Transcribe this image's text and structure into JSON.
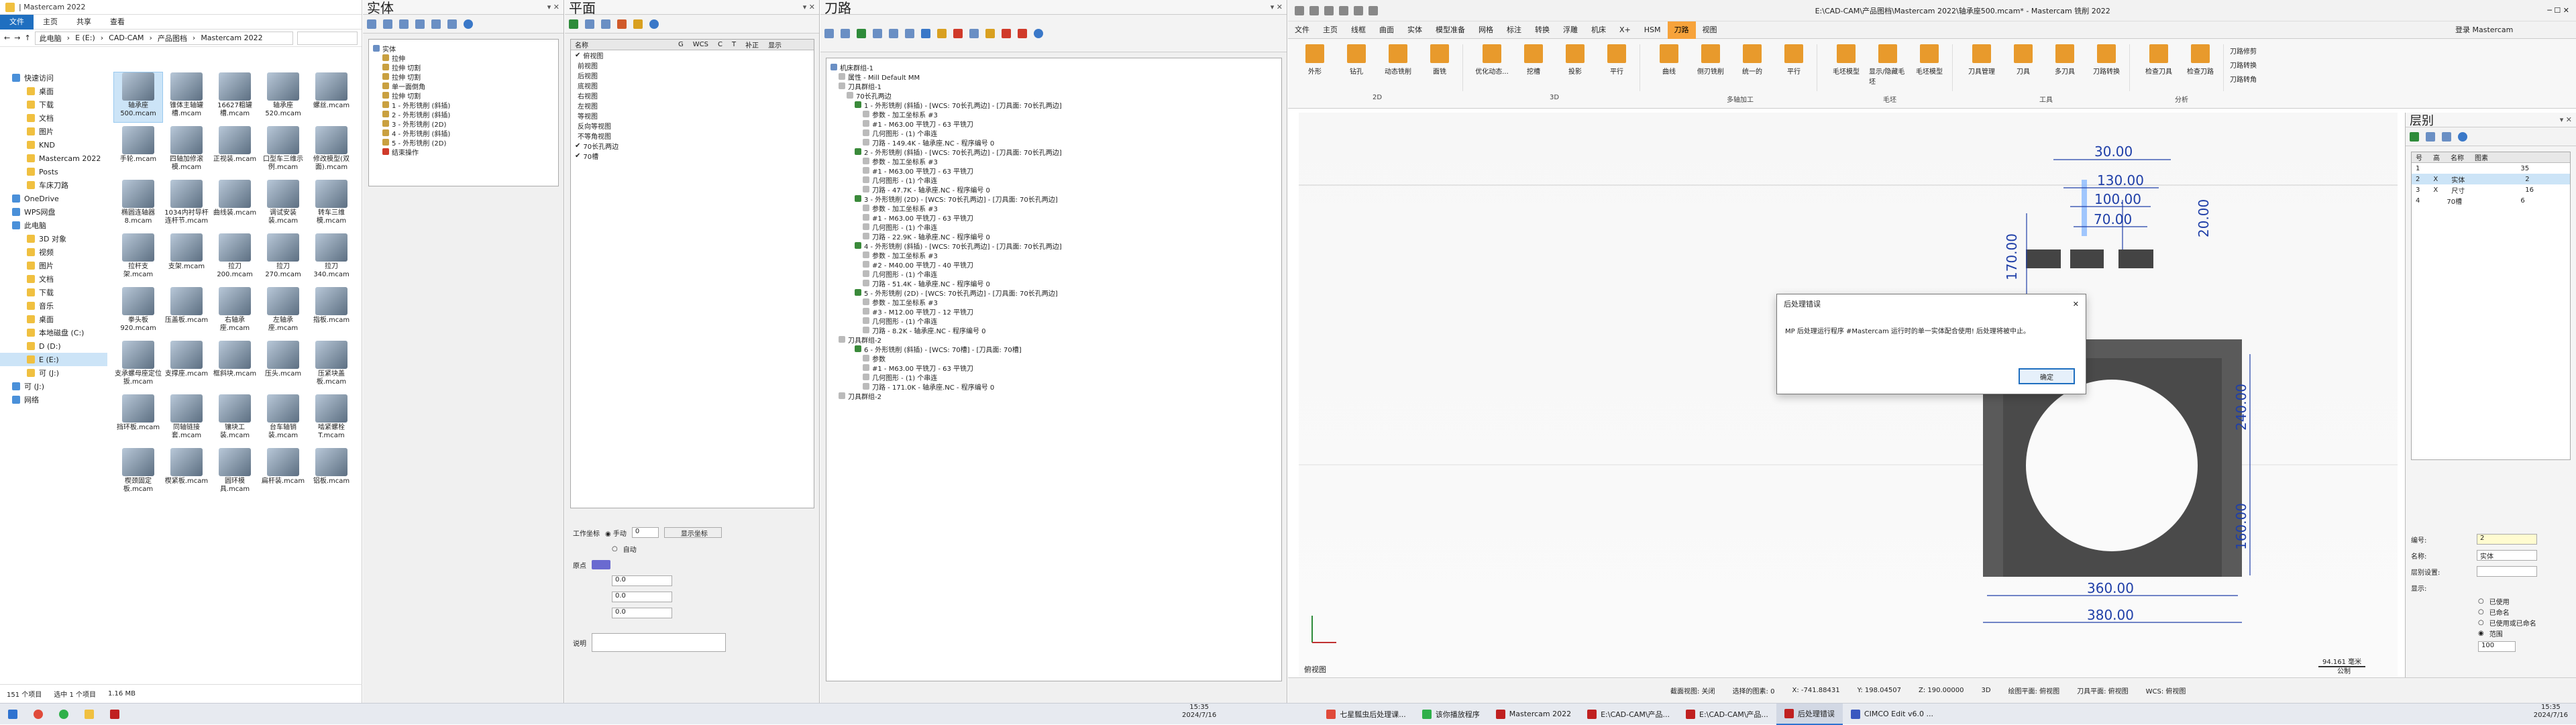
{
  "explorer": {
    "title": "| Mastercam 2022",
    "ribbon_tabs": [
      "文件",
      "主页",
      "共享",
      "查看"
    ],
    "address": [
      "此电脑",
      "E (E:)",
      "CAD-CAM",
      "产品图档",
      "Mastercam 2022"
    ],
    "nav": [
      {
        "label": "快速访问",
        "level": 1
      },
      {
        "label": "桌面",
        "level": 2
      },
      {
        "label": "下载",
        "level": 2
      },
      {
        "label": "文档",
        "level": 2
      },
      {
        "label": "图片",
        "level": 2
      },
      {
        "label": "KND",
        "level": 2
      },
      {
        "label": "Mastercam 2022",
        "level": 2
      },
      {
        "label": "Posts",
        "level": 2
      },
      {
        "label": "车床刀路",
        "level": 2
      },
      {
        "label": "OneDrive",
        "level": 1
      },
      {
        "label": "WPS网盘",
        "level": 1
      },
      {
        "label": "此电脑",
        "level": 1
      },
      {
        "label": "3D 对象",
        "level": 2
      },
      {
        "label": "视频",
        "level": 2
      },
      {
        "label": "图片",
        "level": 2
      },
      {
        "label": "文档",
        "level": 2
      },
      {
        "label": "下载",
        "level": 2
      },
      {
        "label": "音乐",
        "level": 2
      },
      {
        "label": "桌面",
        "level": 2
      },
      {
        "label": "本地磁盘 (C:)",
        "level": 2
      },
      {
        "label": "D (D:)",
        "level": 2
      },
      {
        "label": "E (E:)",
        "level": 2,
        "selected": true
      },
      {
        "label": "可 (J:)",
        "level": 2
      },
      {
        "label": "可 (J:)",
        "level": 1
      },
      {
        "label": "网络",
        "level": 1
      }
    ],
    "files": [
      {
        "name": "轴承座500.mcam",
        "selected": true
      },
      {
        "name": "锥体主轴罐槽.mcam"
      },
      {
        "name": "16627粗罐槽.mcam"
      },
      {
        "name": "轴承座520.mcam"
      },
      {
        "name": "螺丝.mcam"
      },
      {
        "name": "手轮.mcam"
      },
      {
        "name": "四轴加修滚模.mcam"
      },
      {
        "name": "正视装.mcam"
      },
      {
        "name": "口型车三维示例.mcam"
      },
      {
        "name": "修改模型(双面).mcam"
      },
      {
        "name": "椭圆连轴器8.mcam"
      },
      {
        "name": "1034内衬导杆连杆节.mcam"
      },
      {
        "name": "曲线装.mcam"
      },
      {
        "name": "调试安装装.mcam"
      },
      {
        "name": "转车三维模.mcam"
      },
      {
        "name": "拉杆支架.mcam"
      },
      {
        "name": "支架.mcam"
      },
      {
        "name": "拉刀200.mcam"
      },
      {
        "name": "拉刀270.mcam"
      },
      {
        "name": "拉刀340.mcam"
      },
      {
        "name": "拳头板920.mcam"
      },
      {
        "name": "压盖板.mcam"
      },
      {
        "name": "右轴承座.mcam"
      },
      {
        "name": "左轴承座.mcam"
      },
      {
        "name": "指板.mcam"
      },
      {
        "name": "支承螺母座定位扳.mcam"
      },
      {
        "name": "支撑座.mcam"
      },
      {
        "name": "框斜块.mcam"
      },
      {
        "name": "压头.mcam"
      },
      {
        "name": "压紧块盖板.mcam"
      },
      {
        "name": "挡环板.mcam"
      },
      {
        "name": "同轴链接套.mcam"
      },
      {
        "name": "镶块工装.mcam"
      },
      {
        "name": "台车轴销装.mcam"
      },
      {
        "name": "啮紧螺栓T.mcam"
      },
      {
        "name": "楔颈固定板.mcam"
      },
      {
        "name": "楔紧板.mcam"
      },
      {
        "name": "圆环模具.mcam"
      },
      {
        "name": "扁杆装.mcam"
      },
      {
        "name": "铝板.mcam"
      }
    ],
    "status": [
      "151 个项目",
      "选中 1 个项目",
      "1.16 MB"
    ]
  },
  "solids_panel": {
    "title": "实体",
    "tree": [
      "实体",
      "拉伸",
      "拉伸 切割",
      "拉伸 切割",
      "单一面倒角",
      "拉伸 切割",
      "1 - 外形铣削 (斜插)",
      "2 - 外形铣削 (斜插)",
      "3 - 外形铣削 (2D)",
      "4 - 外形铣削 (斜插)",
      "5 - 外形铣削 (2D)",
      "结束操作"
    ]
  },
  "planes_panel": {
    "title": "平面",
    "headers": [
      "名称",
      "G",
      "WCS",
      "C",
      "T",
      "补正",
      "显示"
    ],
    "planes": [
      "俯视图",
      "前视图",
      "后视图",
      "底视图",
      "右视图",
      "左视图",
      "等视图",
      "反向等视图",
      "不等角视图",
      "70长孔两边",
      "70槽"
    ],
    "work_coord_label": "工作坐标",
    "manual": "手动",
    "auto": "自动",
    "work_value": "0",
    "show_axis_btn": "显示坐标",
    "origin_label": "原点",
    "x": "0.0",
    "y": "0.0",
    "z": "0.0",
    "desc_label": "说明"
  },
  "toolpath_panel": {
    "title": "刀路",
    "lines": [
      "机床群组-1",
      "属性 - Mill Default MM",
      "刀具群组-1",
      "70长孔两边",
      "1 - 外形铣削 (斜插) - [WCS: 70长孔两边] - [刀具面: 70长孔两边]",
      "参数 - 加工坐标系 #3",
      "#1 - M63.00 平铣刀 - 63 平铣刀",
      "几何图形 - (1) 个串连",
      "刀路 - 149.4K - 轴承座.NC - 程序编号 0",
      "2 - 外形铣削 (斜插) - [WCS: 70长孔两边] - [刀具面: 70长孔两边]",
      "参数 - 加工坐标系 #3",
      "#1 - M63.00 平铣刀 - 63 平铣刀",
      "几何图形 - (1) 个串连",
      "刀路 - 47.7K - 轴承座.NC - 程序编号 0",
      "3 - 外形铣削 (2D) - [WCS: 70长孔两边] - [刀具面: 70长孔两边]",
      "参数 - 加工坐标系 #3",
      "#1 - M63.00 平铣刀 - 63 平铣刀",
      "几何图形 - (1) 个串连",
      "刀路 - 22.9K - 轴承座.NC - 程序编号 0",
      "4 - 外形铣削 (斜插) - [WCS: 70长孔两边] - [刀具面: 70长孔两边]",
      "参数 - 加工坐标系 #3",
      "#2 - M40.00 平铣刀 - 40 平铣刀",
      "几何图形 - (1) 个串连",
      "刀路 - 51.4K - 轴承座.NC - 程序编号 0",
      "5 - 外形铣削 (2D) - [WCS: 70长孔两边] - [刀具面: 70长孔两边]",
      "参数 - 加工坐标系 #3",
      "#3 - M12.00 平铣刀 - 12 平铣刀",
      "几何图形 - (1) 个串连",
      "刀路 - 8.2K - 轴承座.NC - 程序编号 0",
      "刀具群组-2",
      "6 - 外形铣削 (斜插) - [WCS: 70槽] - [刀具面: 70槽]",
      "参数",
      "#1 - M63.00 平铣刀 - 63 平铣刀",
      "几何图形 - (1) 个串连",
      "刀路 - 171.0K - 轴承座.NC - 程序编号 0",
      "刀具群组-2"
    ]
  },
  "mastercam": {
    "title": "E:\\CAD-CAM\\产品图档\\Mastercam 2022\\轴承座500.mcam* - Mastercam 铣削 2022",
    "tabs": [
      "文件",
      "主页",
      "线框",
      "曲面",
      "实体",
      "模型准备",
      "网格",
      "标注",
      "转换",
      "浮雕",
      "机床",
      "X+",
      "HSM",
      "刀路",
      "视图"
    ],
    "active_tab": "刀路",
    "user": "登录 Mastercam",
    "ribbon_groups": [
      {
        "label": "2D",
        "buttons": [
          "外形",
          "钻孔",
          "动态铣削",
          "面铣"
        ]
      },
      {
        "label": "3D",
        "buttons": [
          "优化动态...",
          "挖槽",
          "投影",
          "平行"
        ]
      },
      {
        "label": "多轴加工",
        "buttons": [
          "曲线",
          "侧刃铣削",
          "统一的",
          "平行"
        ]
      },
      {
        "label": "毛坯",
        "buttons": [
          "毛坯模型",
          "显示/隐藏毛坯",
          "毛坯模型"
        ]
      },
      {
        "label": "工具",
        "buttons": [
          "刀具管理",
          "刀具",
          "多刀具",
          "刀路转换"
        ]
      },
      {
        "label": "分析",
        "buttons": [
          "检查刀具",
          "检查刀路"
        ]
      }
    ],
    "small_buttons": [
      "刀路修剪",
      "刀路转换",
      "刀路转角"
    ],
    "view_label": "俯视图",
    "scale": "94.161 毫米",
    "scale_unit": "公制",
    "dims": {
      "d30": "30.00",
      "d130": "130.00",
      "d100": "100.00",
      "d70": "70.00",
      "d20": "20.00",
      "d170": "170.00",
      "d240": "240.00",
      "d160": "160.00",
      "d360": "360.00",
      "d380": "380.00"
    },
    "status": {
      "selection": "截面视图: 关闭",
      "selected": "选择的图素: 0",
      "x": "X: -741.88431",
      "y": "Y: 198.04507",
      "z": "Z: 190.00000",
      "mode": "3D",
      "plane": "绘图平面: 俯视图",
      "tool_plane": "刀具平面: 俯视图",
      "wcs": "WCS: 俯视图"
    }
  },
  "levels_panel": {
    "title": "层别",
    "headers": [
      "号",
      "高",
      "名称",
      "图素"
    ],
    "rows": [
      {
        "num": "1",
        "vis": "",
        "name": "",
        "count": "35"
      },
      {
        "num": "2",
        "vis": "X",
        "name": "实体",
        "count": "2"
      },
      {
        "num": "3",
        "vis": "X",
        "name": "尺寸",
        "count": "16"
      },
      {
        "num": "4",
        "vis": "",
        "name": "70槽",
        "count": "6"
      }
    ],
    "number_label": "编号:",
    "number_value": "2",
    "name_label": "名称:",
    "name_value": "实体",
    "set_label": "层别设置:",
    "show_label": "显示:",
    "opt1": "已使用",
    "opt2": "已命名",
    "opt3": "已使用或已命名",
    "opt4": "范围",
    "range_value": "100"
  },
  "dialog": {
    "title": "后处理错误",
    "message": "MP 后处理运行程序 #Mastercam 运行时的单一实体配合使用! 后处理将被中止。",
    "ok": "确定"
  },
  "taskbar": {
    "items": [
      "七星瓢虫后处理课...",
      "该你播放程序",
      "Mastercam 2022",
      "E:\\CAD-CAM\\产品...",
      "E:\\CAD-CAM\\产品...",
      "后处理错误",
      "CIMCO Edit v6.0 ..."
    ],
    "time": "15:35",
    "date": "2024/7/16",
    "time2": "15:35",
    "date2": "2024/7/16"
  },
  "colors": {
    "accent": "#1f6fc0",
    "mc_orange": "#f7a33b",
    "selected": "#cce4f7"
  }
}
